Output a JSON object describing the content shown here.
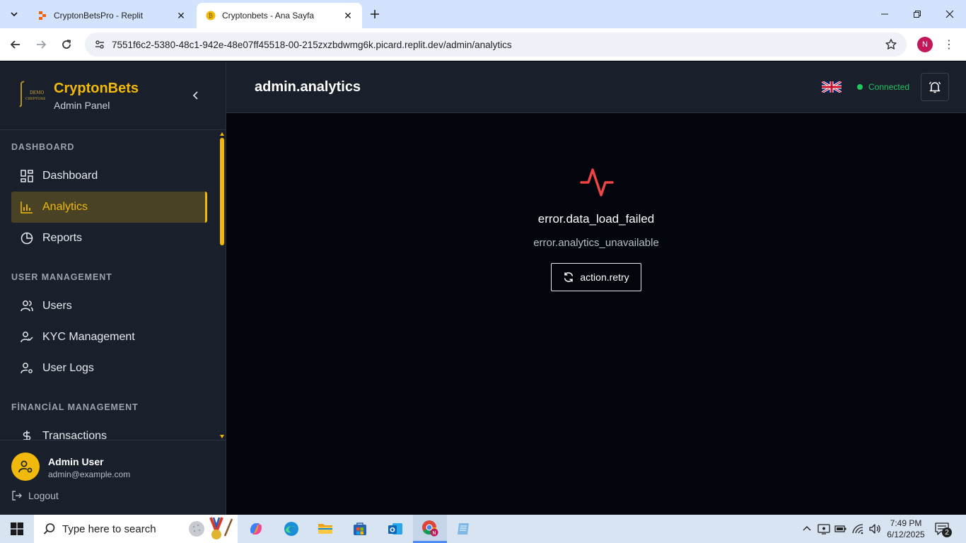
{
  "browser": {
    "tabs": [
      {
        "title": "CryptonBetsPro - Replit",
        "active": false
      },
      {
        "title": "Cryptonbets - Ana Sayfa",
        "active": true
      }
    ],
    "url": "7551f6c2-5380-48c1-942e-48e07ff45518-00-215zxzbdwmg6k.picard.replit.dev/admin/analytics",
    "profile_initial": "N"
  },
  "sidebar": {
    "brand_name": "CryptonBets",
    "brand_sub": "Admin Panel",
    "sections": {
      "dashboard": "DASHBOARD",
      "user_management": "USER MANAGEMENT",
      "financial_management": "FİNANCİAL MANAGEMENT"
    },
    "items": [
      {
        "label": "Dashboard",
        "icon": "dashboard-grid-icon",
        "active": false
      },
      {
        "label": "Analytics",
        "icon": "bar-chart-icon",
        "active": true
      },
      {
        "label": "Reports",
        "icon": "pie-chart-icon",
        "active": false
      },
      {
        "label": "Users",
        "icon": "users-icon",
        "active": false
      },
      {
        "label": "KYC Management",
        "icon": "user-check-icon",
        "active": false
      },
      {
        "label": "User Logs",
        "icon": "user-cog-icon",
        "active": false
      },
      {
        "label": "Transactions",
        "icon": "dollar-icon",
        "active": false
      }
    ],
    "user": {
      "name": "Admin User",
      "email": "admin@example.com"
    },
    "logout_label": "Logout"
  },
  "header": {
    "title": "admin.analytics",
    "connection_status": "Connected"
  },
  "main": {
    "error_title": "error.data_load_failed",
    "error_message": "error.analytics_unavailable",
    "retry_label": "action.retry"
  },
  "taskbar": {
    "search_placeholder": "Type here to search",
    "time": "7:49 PM",
    "date": "6/12/2025",
    "notification_count": "2"
  },
  "colors": {
    "accent": "#f0b90b",
    "sidebar_bg": "#1a202b",
    "main_bg": "#03050c",
    "error": "#ef4444",
    "connected": "#22c55e"
  }
}
